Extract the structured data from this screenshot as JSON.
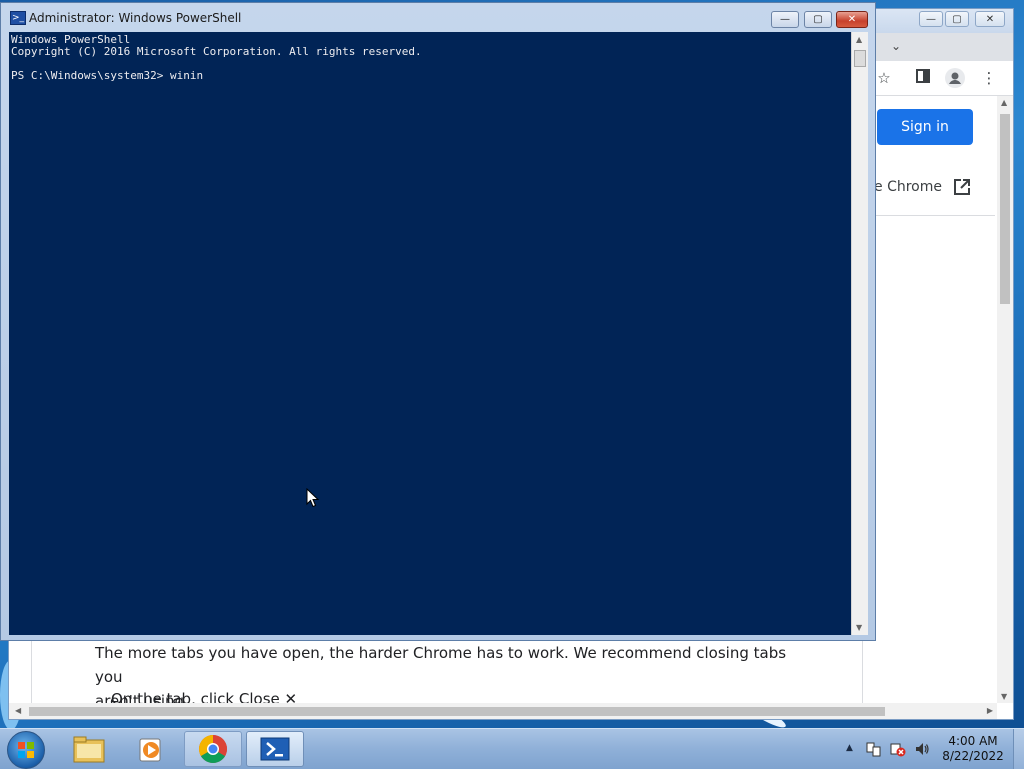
{
  "powershell": {
    "title": "Administrator: Windows PowerShell",
    "buttons": {
      "minimize": "—",
      "maximize": "▢",
      "close": "✕"
    },
    "console": {
      "line1": "Windows PowerShell",
      "line2": "Copyright (C) 2016 Microsoft Corporation. All rights reserved.",
      "prompt": "PS C:\\Windows\\system32> ",
      "input": "winin"
    }
  },
  "chrome": {
    "signin_label": "Sign in",
    "side_link": "e Chrome",
    "article_line1": "The more tabs you have open, the harder Chrome has to work. We recommend closing tabs you",
    "article_line2": "aren't using.",
    "article_bullet": "On the tab, click Close ✕",
    "toolbar_icons": [
      "star-icon",
      "side-panel-icon",
      "profile-icon",
      "menu-dots-icon"
    ]
  },
  "taskbar": {
    "apps": [
      "file-explorer",
      "media-player",
      "chrome",
      "powershell"
    ],
    "active_app": "powershell",
    "clock_time": "4:00 AM",
    "clock_date": "8/22/2022"
  },
  "colors": {
    "console_bg": "#012456",
    "console_fg": "#eeedf0",
    "signin_blue": "#1a73e8"
  }
}
